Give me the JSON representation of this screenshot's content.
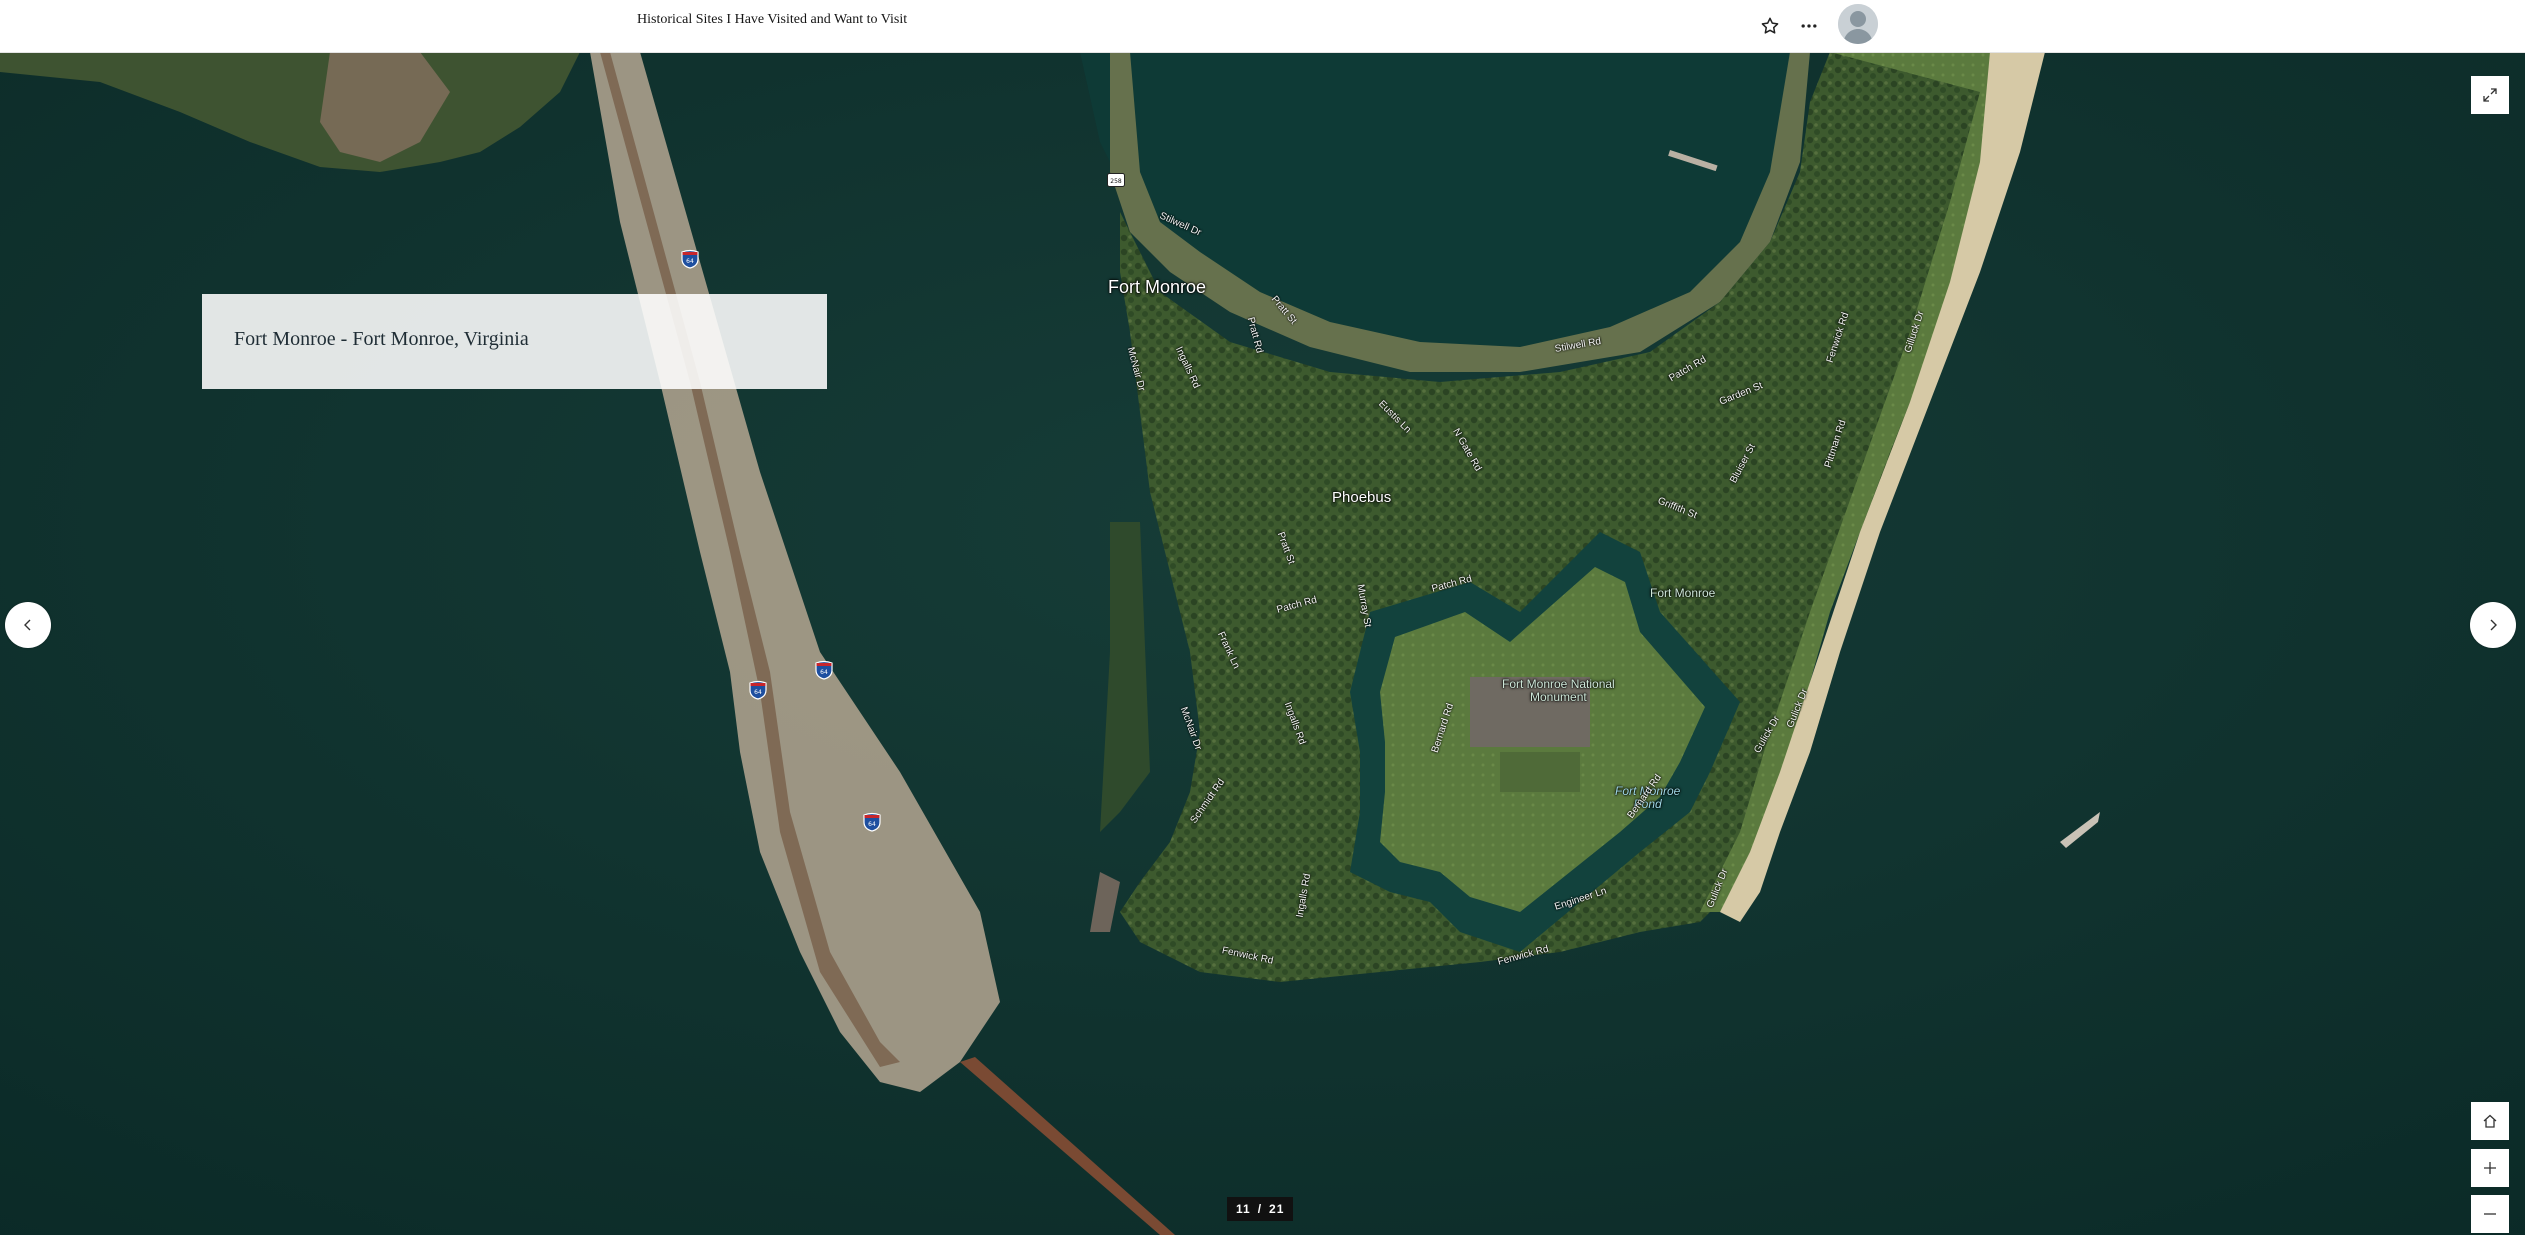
{
  "header": {
    "title": "Historical Sites I Have Visited and Want to Visit",
    "favorite_icon": "star-icon",
    "more_icon": "more-horizontal-icon",
    "avatar_icon": "user-avatar-icon"
  },
  "slide": {
    "caption": "Fort Monroe - Fort Monroe, Virginia",
    "current": "11",
    "separator": "/",
    "total": "21"
  },
  "map": {
    "basemap": "imagery",
    "places": {
      "city": "Fort Monroe",
      "neighborhood": "Phoebus",
      "fort_label": "Fort Monroe",
      "monument_line1": "Fort Monroe National",
      "monument_line2": "Monument",
      "pond_line1": "Fort Monroe",
      "pond_line2": "Pond"
    },
    "streets": {
      "stilwell_1": "Stilwell Dr",
      "stilwell_2": "Stilwell Rd",
      "pratt_st": "Pratt St",
      "pratt_rd": "Pratt Rd",
      "mcnair_1": "McNair Dr",
      "mcnair_2": "McNair Dr",
      "ingalls_1": "Ingalls Rd",
      "ingalls_2": "Ingalls Rd",
      "ingalls_3": "Ingalls Rd",
      "eustis": "Eustis Ln",
      "n_gate": "N Gate Rd",
      "patch_1": "Patch Rd",
      "patch_2": "Patch Rd",
      "patch_3": "Patch Rd",
      "garden": "Garden St",
      "griffith": "Griffith St",
      "bluiser": "Bluiser St",
      "fenwick_1": "Fenwick Rd",
      "fenwick_2": "Fenwick Rd",
      "fenwick_3": "Fenwick Rd",
      "gilluck_1": "Gilluck Dr",
      "gilluck_2": "Gulick Dr",
      "gilluck_3": "Gulick Dr",
      "gilluck_4": "Gulick Dr",
      "pratt_2": "Pratt St",
      "murray": "Murray St",
      "frank": "Frank Ln",
      "bernard_1": "Bernard Rd",
      "bernard_2": "Bernard Rd",
      "engineer": "Engineer Ln",
      "schmidt": "Schmidt Rd",
      "pittman": "Pittman Rd"
    },
    "shields": [
      "64",
      "64",
      "64",
      "64",
      "258"
    ]
  },
  "controls": {
    "expand_icon": "expand-icon",
    "prev_icon": "chevron-left-icon",
    "next_icon": "chevron-right-icon",
    "home_icon": "home-icon",
    "zoom_in_icon": "plus-icon",
    "zoom_out_icon": "minus-icon"
  }
}
